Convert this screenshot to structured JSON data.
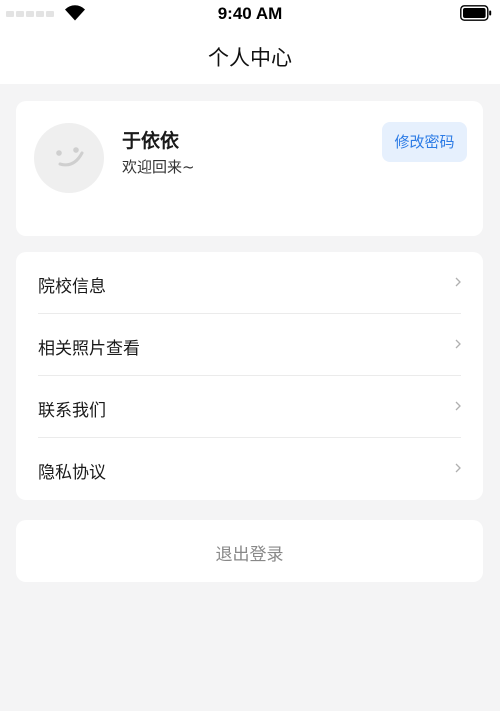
{
  "status_bar": {
    "time": "9:40 AM",
    "icons": [
      "signal-icon",
      "wifi-icon",
      "battery-icon"
    ]
  },
  "nav": {
    "title": "个人中心"
  },
  "profile": {
    "name": "于依依",
    "greeting": "欢迎回来~",
    "change_password_label": "修改密码",
    "avatar_icon": "smiley-face-icon"
  },
  "menu": {
    "items": [
      {
        "label": "院校信息"
      },
      {
        "label": "相关照片查看"
      },
      {
        "label": "联系我们"
      },
      {
        "label": "隐私协议"
      }
    ],
    "chevron_icon": "chevron-right-icon"
  },
  "logout": {
    "label": "退出登录"
  },
  "colors": {
    "page_background": "#f4f4f5",
    "card_background": "#ffffff",
    "accent": "#2c7be5",
    "accent_background": "#e6f0fd",
    "muted_text": "#888888"
  }
}
